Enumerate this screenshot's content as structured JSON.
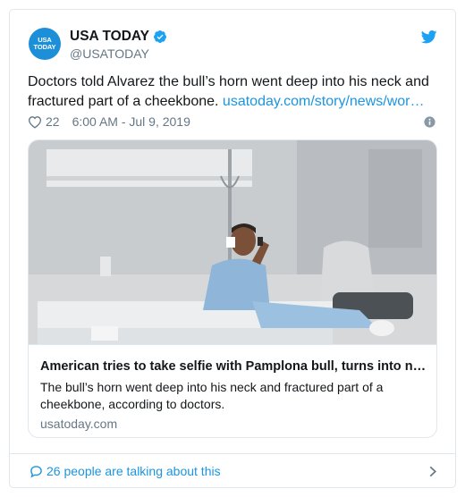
{
  "account": {
    "display_name": "USA TODAY",
    "handle": "@USATODAY",
    "avatar_text_1": "USA",
    "avatar_text_2": "TODAY",
    "verified": true
  },
  "tweet": {
    "text": "Doctors told Alvarez the bull’s horn went deep into his neck and fractured part of a cheekbone.",
    "link_text": "usatoday.com/story/news/wor…",
    "like_count": "22",
    "timestamp": "6:00 AM - Jul 9, 2019"
  },
  "card": {
    "title": "American tries to take selfie with Pamplona bull, turns into ne…",
    "description": "The bull’s horn went deep into his neck and fractured part of a cheekbone, according to doctors.",
    "domain": "usatoday.com"
  },
  "footer": {
    "talking_text": "26 people are talking about this"
  },
  "colors": {
    "accent": "#1b95e0",
    "avatar_bg": "#1d8fd8",
    "muted": "#657786",
    "border": "#e1e8ed"
  },
  "icons": [
    "verified-badge-icon",
    "twitter-bird-icon",
    "heart-icon",
    "info-icon",
    "speech-bubble-icon",
    "chevron-right-icon"
  ]
}
